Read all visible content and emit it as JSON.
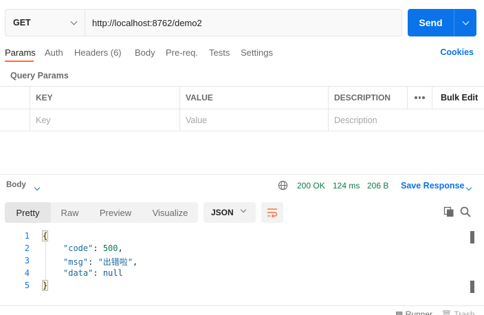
{
  "request": {
    "method": "GET",
    "url": "http://localhost:8762/demo2",
    "send_label": "Send"
  },
  "tabs": [
    {
      "label": "Params",
      "active": true
    },
    {
      "label": "Auth"
    },
    {
      "label": "Headers (6)"
    },
    {
      "label": "Body"
    },
    {
      "label": "Pre-req."
    },
    {
      "label": "Tests"
    },
    {
      "label": "Settings"
    }
  ],
  "cookies_label": "Cookies",
  "query_params": {
    "title": "Query Params",
    "columns": [
      "KEY",
      "VALUE",
      "DESCRIPTION"
    ],
    "bulk_edit_label": "Bulk Edit",
    "placeholders": {
      "key": "Key",
      "value": "Value",
      "description": "Description"
    }
  },
  "response": {
    "section_label": "Body",
    "status": "200 OK",
    "time": "124 ms",
    "size": "206 B",
    "save_label": "Save Response",
    "view_tabs": [
      "Pretty",
      "Raw",
      "Preview",
      "Visualize"
    ],
    "active_view": "Pretty",
    "format": "JSON",
    "lines": [
      {
        "num": "1",
        "text": "{"
      },
      {
        "num": "2",
        "key": "\"code\"",
        "value": "500",
        "suffix": ","
      },
      {
        "num": "3",
        "key": "\"msg\"",
        "value": "\"出错啦\"",
        "suffix": ","
      },
      {
        "num": "4",
        "key": "\"data\"",
        "value": "null",
        "suffix": ""
      },
      {
        "num": "5",
        "text": "}"
      }
    ]
  },
  "footer": {
    "runner": "Runner",
    "trash": "Trash"
  },
  "colors": {
    "accent": "#0b73ea",
    "active_tab": "#ff6c37",
    "status_ok": "#097b48"
  }
}
